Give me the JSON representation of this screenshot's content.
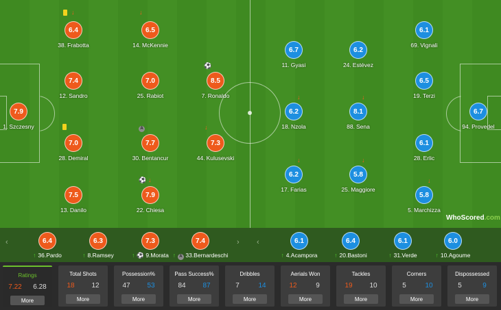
{
  "home_players": [
    {
      "rating": "6.4",
      "number": "38.",
      "name": "Frabotta"
    },
    {
      "rating": "6.5",
      "number": "14.",
      "name": "McKennie"
    },
    {
      "rating": "7.4",
      "number": "12.",
      "name": "Sandro"
    },
    {
      "rating": "7.0",
      "number": "25.",
      "name": "Rabiot"
    },
    {
      "rating": "8.5",
      "number": "7.",
      "name": "Ronaldo"
    },
    {
      "rating": "7.9",
      "number": "1.",
      "name": "Szczesny"
    },
    {
      "rating": "7.0",
      "number": "28.",
      "name": "Demiral"
    },
    {
      "rating": "7.7",
      "number": "30.",
      "name": "Bentancur"
    },
    {
      "rating": "7.3",
      "number": "44.",
      "name": "Kulusevski"
    },
    {
      "rating": "7.5",
      "number": "13.",
      "name": "Danilo"
    },
    {
      "rating": "7.9",
      "number": "22.",
      "name": "Chiesa"
    }
  ],
  "away_players": [
    {
      "rating": "6.1",
      "number": "69.",
      "name": "Vignali"
    },
    {
      "rating": "6.7",
      "number": "11.",
      "name": "Gyasi"
    },
    {
      "rating": "6.2",
      "number": "24.",
      "name": "Estévez"
    },
    {
      "rating": "6.5",
      "number": "19.",
      "name": "Terzi"
    },
    {
      "rating": "6.2",
      "number": "18.",
      "name": "Nzola"
    },
    {
      "rating": "8.1",
      "number": "88.",
      "name": "Sena"
    },
    {
      "rating": "6.7",
      "number": "94.",
      "name": "Provedel"
    },
    {
      "rating": "6.1",
      "number": "28.",
      "name": "Erlic"
    },
    {
      "rating": "6.2",
      "number": "17.",
      "name": "Farias"
    },
    {
      "rating": "5.8",
      "number": "25.",
      "name": "Maggiore"
    },
    {
      "rating": "5.8",
      "number": "5.",
      "name": "Marchizza"
    }
  ],
  "captain_badge": "A",
  "logo": {
    "text": "WhoScored",
    "suffix": ".com"
  },
  "home_subs": [
    {
      "rating": "6.4",
      "number": "36.",
      "name": "Pardo"
    },
    {
      "rating": "6.3",
      "number": "8.",
      "name": "Ramsey"
    },
    {
      "rating": "7.3",
      "number": "9.",
      "name": "Morata"
    },
    {
      "rating": "7.4",
      "number": "33.",
      "name": "Bernardeschi"
    }
  ],
  "away_subs": [
    {
      "rating": "6.1",
      "number": "4.",
      "name": "Acampora"
    },
    {
      "rating": "6.4",
      "number": "20.",
      "name": "Bastoni"
    },
    {
      "rating": "6.1",
      "number": "31.",
      "name": "Verde"
    },
    {
      "rating": "6.0",
      "number": "10.",
      "name": "Agoume"
    }
  ],
  "stats": [
    {
      "title": "Ratings",
      "home": "7.22",
      "away": "6.28",
      "more": "More"
    },
    {
      "title": "Total Shots",
      "home": "18",
      "away": "12",
      "more": "More"
    },
    {
      "title": "Possession%",
      "home": "47",
      "away": "53",
      "more": "More"
    },
    {
      "title": "Pass Success%",
      "home": "84",
      "away": "87",
      "more": "More"
    },
    {
      "title": "Dribbles",
      "home": "7",
      "away": "14",
      "more": "More"
    },
    {
      "title": "Aerials Won",
      "home": "12",
      "away": "9",
      "more": "More"
    },
    {
      "title": "Tackles",
      "home": "19",
      "away": "10",
      "more": "More"
    },
    {
      "title": "Corners",
      "home": "5",
      "away": "10",
      "more": "More"
    },
    {
      "title": "Dispossessed",
      "home": "5",
      "away": "9",
      "more": "More"
    }
  ],
  "colors": {
    "home": "#ee5a1c",
    "away": "#1d8fe0",
    "active": "#6cc12c"
  }
}
